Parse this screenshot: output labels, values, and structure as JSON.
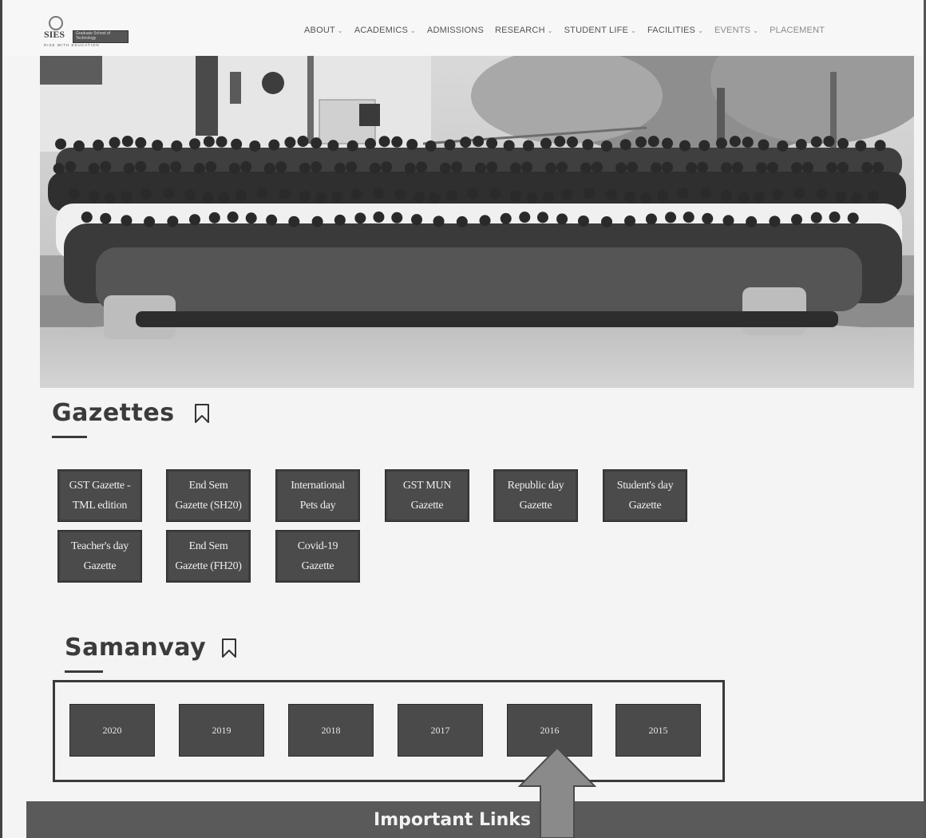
{
  "logo": {
    "abbr": "SIES",
    "plate_line1": "Graduate School of",
    "plate_line2": "Technology",
    "tagline": "RISE WITH EDUCATION"
  },
  "nav": {
    "items": [
      {
        "label": "ABOUT",
        "has_dropdown": true
      },
      {
        "label": "ACADEMICS",
        "has_dropdown": true
      },
      {
        "label": "ADMISSIONS",
        "has_dropdown": false
      },
      {
        "label": "RESEARCH",
        "has_dropdown": true
      },
      {
        "label": "STUDENT LIFE",
        "has_dropdown": true
      },
      {
        "label": "FACILITIES",
        "has_dropdown": true
      },
      {
        "label": "EVENTS",
        "has_dropdown": true
      },
      {
        "label": "PLACEMENT",
        "has_dropdown": false
      }
    ]
  },
  "gazettes": {
    "title": "Gazettes",
    "buttons": [
      {
        "line1": "GST Gazette -",
        "line2": "TML edition"
      },
      {
        "line1": "End Sem",
        "line2": "Gazette (SH20)"
      },
      {
        "line1": "International",
        "line2": "Pets day"
      },
      {
        "line1": "GST MUN",
        "line2": "Gazette"
      },
      {
        "line1": "Republic day",
        "line2": "Gazette"
      },
      {
        "line1": "Student's day",
        "line2": "Gazette"
      },
      {
        "line1": "Teacher's day",
        "line2": "Gazette"
      },
      {
        "line1": "End Sem",
        "line2": "Gazette (FH20)"
      },
      {
        "line1": "Covid-19",
        "line2": "Gazette"
      }
    ]
  },
  "samanvay": {
    "title": "Samanvay",
    "years": [
      "2020",
      "2019",
      "2018",
      "2017",
      "2016",
      "2015"
    ]
  },
  "important_links": {
    "label": "Important Links"
  },
  "icons": {
    "bookmark": "bookmark-icon",
    "dropdown": "chevron-down-icon",
    "annotation": "up-arrow-icon"
  }
}
